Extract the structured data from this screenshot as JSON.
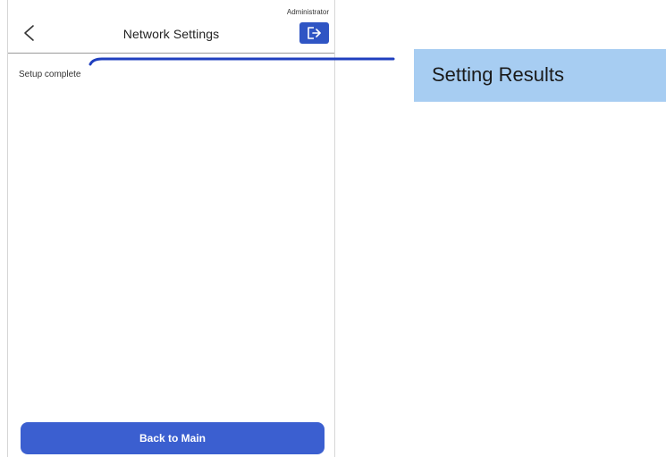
{
  "header": {
    "back_icon": "chevron-left-icon",
    "title": "Network Settings",
    "role": "Administrator",
    "logout_icon": "logout-icon"
  },
  "content": {
    "status": "Setup complete"
  },
  "footer": {
    "back_to_main_label": "Back to Main"
  },
  "callout": {
    "label": "Setting Results"
  },
  "colors": {
    "accent": "#3b5fd0",
    "logout_bg": "#2f55c4",
    "callout_bg": "#a7cdf2",
    "callout_line": "#1f3fbf"
  }
}
